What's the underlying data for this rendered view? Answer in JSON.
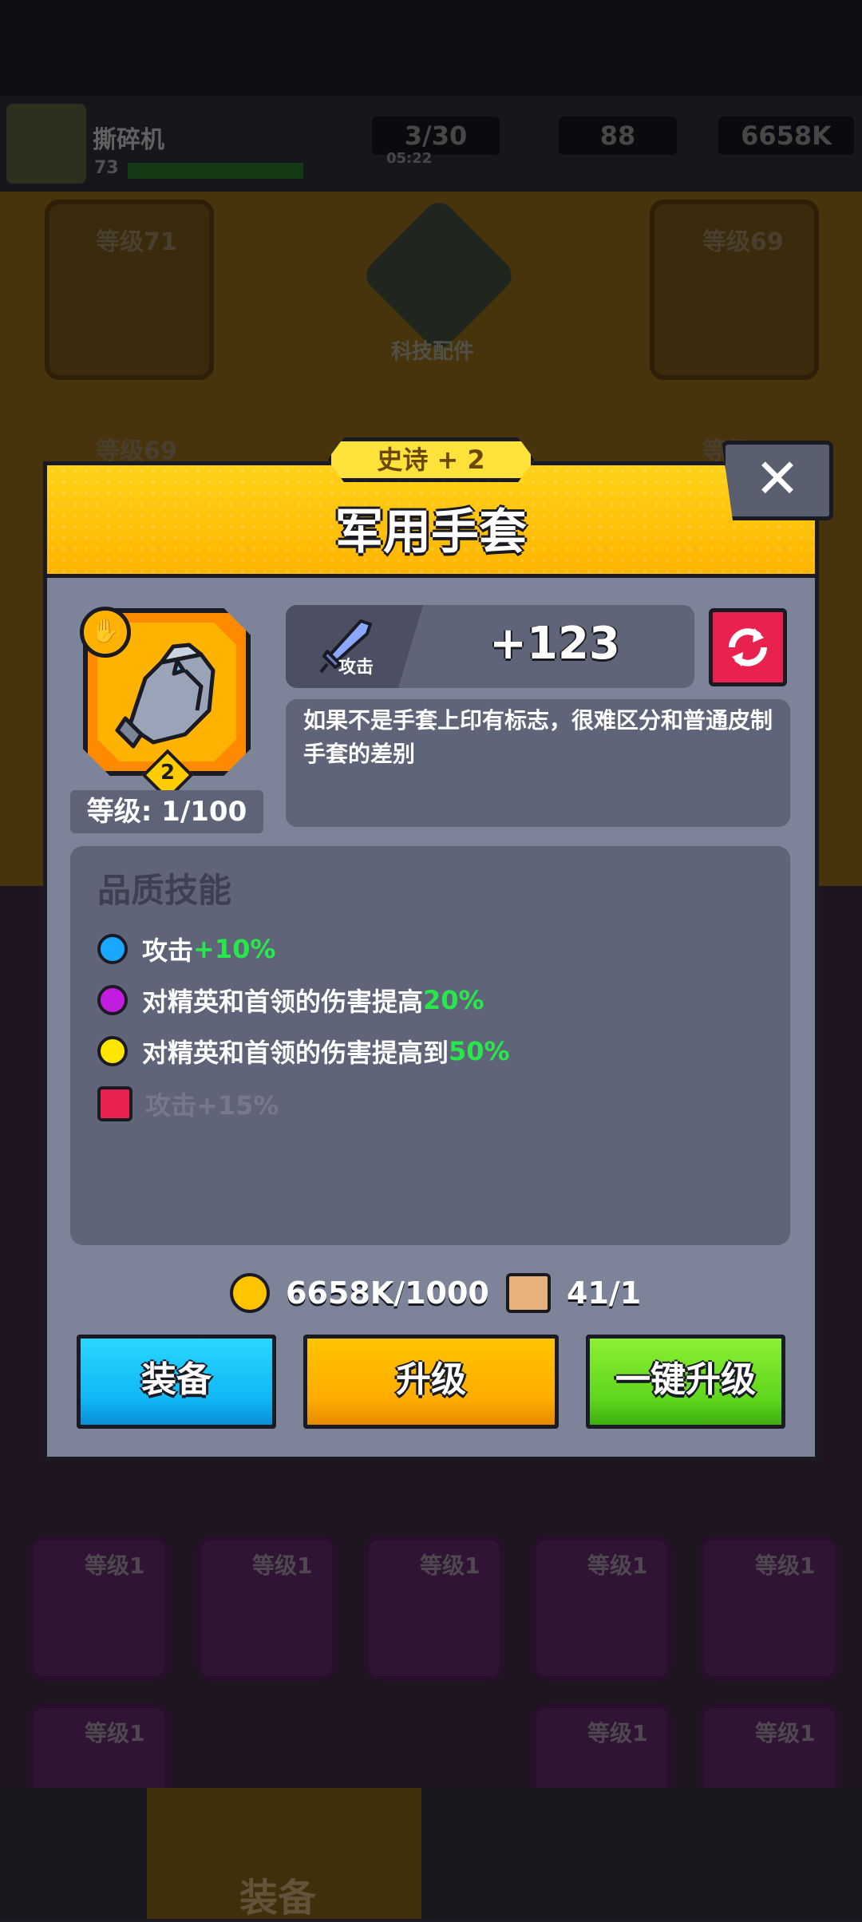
{
  "background": {
    "player_name": "撕碎机",
    "player_level": "73",
    "energy": "3/30",
    "energy_timer": "05:22",
    "gems": "88",
    "gold": "6658K",
    "tech_label": "科技配件",
    "slot_labels": [
      "等级71",
      "等级69",
      "等级69",
      "等级"
    ],
    "purple_slot_label": "等级1",
    "nav_active_label": "装备"
  },
  "modal": {
    "rarity": "史诗 + 2",
    "title": "军用手套",
    "close_label": "✕",
    "item": {
      "stars": "2",
      "level_text": "等级: 1/100"
    },
    "stat": {
      "label": "攻击",
      "value": "+123"
    },
    "description": "如果不是手套上印有标志，很难区分和普通皮制手套的差别",
    "skills_title": "品质技能",
    "skills": [
      {
        "text": "攻击",
        "value": "+10%",
        "color": "#1aa7ff"
      },
      {
        "text": "对精英和首领的伤害提高",
        "value": "20%",
        "color": "#c21ce0"
      },
      {
        "text": "对精英和首领的伤害提高到",
        "value": "50%",
        "color": "#ffe600"
      }
    ],
    "locked_skill": "攻击+15%",
    "cost": {
      "gold": "6658K/1000",
      "scrolls": "41/1"
    },
    "buttons": {
      "equip": "装备",
      "upgrade": "升级",
      "one_click": "一键升级"
    }
  }
}
